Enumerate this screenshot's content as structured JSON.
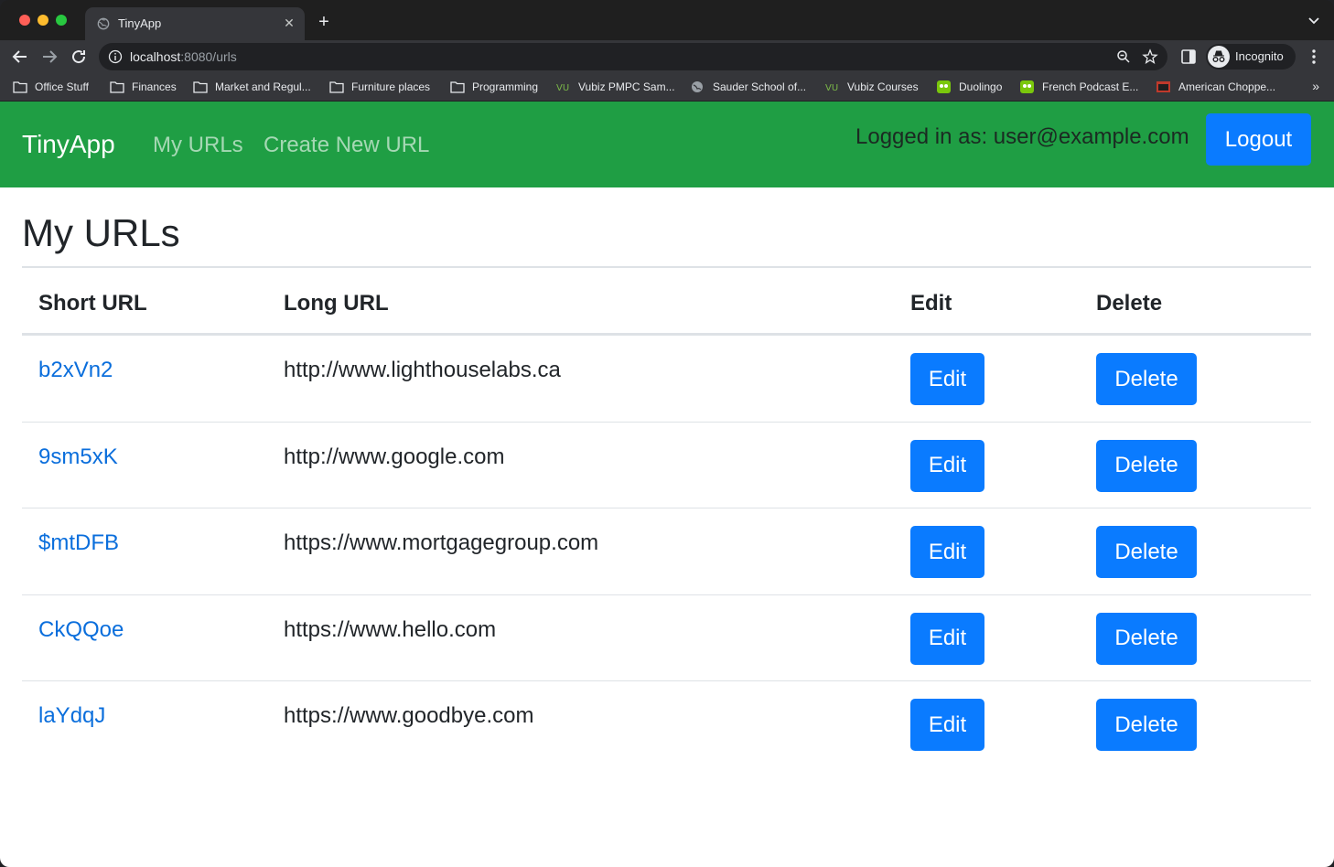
{
  "browser": {
    "tab_title": "TinyApp",
    "url_host": "localhost",
    "url_rest": ":8080/urls",
    "profile_label": "Incognito",
    "bookmarks": [
      {
        "label": "Office Stuff",
        "icon": "folder-icon"
      },
      {
        "label": "Finances",
        "icon": "folder-icon"
      },
      {
        "label": "Market and Regul...",
        "icon": "folder-icon"
      },
      {
        "label": "Furniture places",
        "icon": "folder-icon"
      },
      {
        "label": "Programming",
        "icon": "folder-icon"
      },
      {
        "label": "Vubiz PMPC Sam...",
        "icon": "vubiz-icon"
      },
      {
        "label": "Sauder School of...",
        "icon": "globe-icon"
      },
      {
        "label": "Vubiz Courses",
        "icon": "vubiz-icon"
      },
      {
        "label": "Duolingo",
        "icon": "duolingo-icon"
      },
      {
        "label": "French Podcast E...",
        "icon": "duolingo-icon"
      },
      {
        "label": "American Choppe...",
        "icon": "chopper-icon"
      }
    ],
    "bookmarks_more": "»"
  },
  "navbar": {
    "brand": "TinyApp",
    "link_my_urls": "My URLs",
    "link_create": "Create New URL",
    "logged_in": "Logged in as: user@example.com",
    "logout": "Logout",
    "color": "#1f9e44"
  },
  "main": {
    "heading": "My URLs",
    "columns": [
      "Short URL",
      "Long URL",
      "Edit",
      "Delete"
    ],
    "rows": [
      {
        "short": "b2xVn2",
        "long": "http://www.lighthouselabs.ca",
        "edit": "Edit",
        "delete": "Delete"
      },
      {
        "short": "9sm5xK",
        "long": "http://www.google.com",
        "edit": "Edit",
        "delete": "Delete"
      },
      {
        "short": "$mtDFB",
        "long": "https://www.mortgagegroup.com",
        "edit": "Edit",
        "delete": "Delete"
      },
      {
        "short": "CkQQoe",
        "long": "https://www.hello.com",
        "edit": "Edit",
        "delete": "Delete"
      },
      {
        "short": "laYdqJ",
        "long": "https://www.goodbye.com",
        "edit": "Edit",
        "delete": "Delete"
      }
    ],
    "button_color": "#0a7bff",
    "link_color": "#0a6edc"
  }
}
